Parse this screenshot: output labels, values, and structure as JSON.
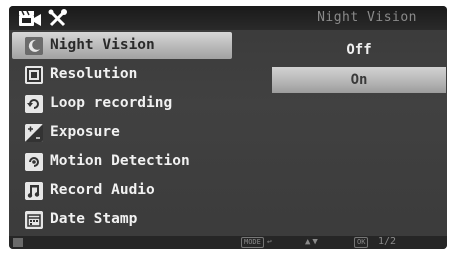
{
  "topbar": {
    "title": "Night Vision",
    "icons": [
      "video-camera-icon",
      "tools-icon"
    ]
  },
  "menu": {
    "items": [
      {
        "label": "Night Vision",
        "icon": "moon-icon",
        "selected": true
      },
      {
        "label": "Resolution",
        "icon": "resolution-icon",
        "selected": false
      },
      {
        "label": "Loop recording",
        "icon": "loop-icon",
        "selected": false
      },
      {
        "label": "Exposure",
        "icon": "exposure-icon",
        "selected": false
      },
      {
        "label": "Motion Detection",
        "icon": "motion-icon",
        "selected": false
      },
      {
        "label": "Record Audio",
        "icon": "music-note-icon",
        "selected": false
      },
      {
        "label": "Date Stamp",
        "icon": "date-stamp-icon",
        "selected": false
      }
    ]
  },
  "options": {
    "items": [
      {
        "label": "Off",
        "selected": false
      },
      {
        "label": "On",
        "selected": true
      }
    ]
  },
  "bottombar": {
    "mode_label": "MODE",
    "ok_label": "OK",
    "page": "1/2"
  },
  "colors": {
    "screen_bg": "#3d3d3d",
    "highlight": "#c0c0c0",
    "text": "#f1f1f1"
  }
}
